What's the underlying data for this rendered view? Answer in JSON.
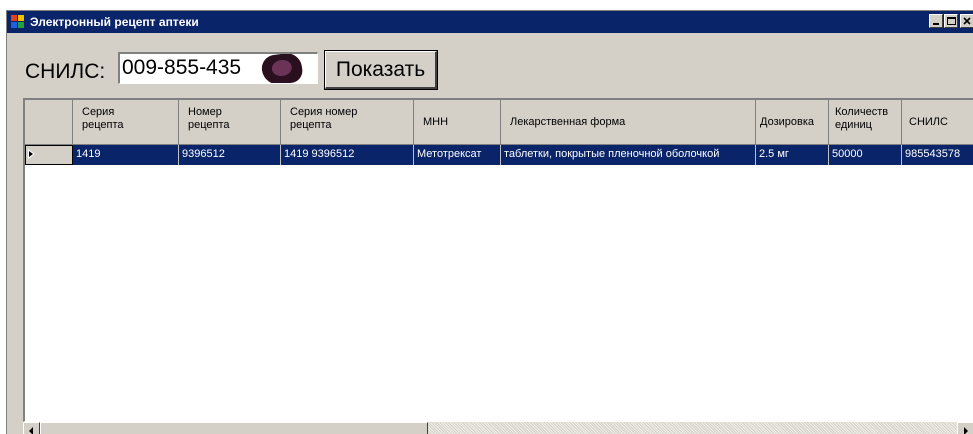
{
  "window": {
    "title": "Электронный рецепт аптеки",
    "controls": [
      "minimize",
      "maximize",
      "close"
    ]
  },
  "search": {
    "label": "СНИЛС:",
    "value": "009-855-435",
    "button_label": "Показать"
  },
  "grid": {
    "columns": [
      {
        "key": "series",
        "label": "Серия\nрецепта"
      },
      {
        "key": "number",
        "label": "Номер\nрецепта"
      },
      {
        "key": "series_number",
        "label": "Серия номер\nрецепта"
      },
      {
        "key": "inn",
        "label": "МНН"
      },
      {
        "key": "form",
        "label": "Лекарственная форма"
      },
      {
        "key": "dosage",
        "label": "Дозировка"
      },
      {
        "key": "quantity",
        "label": "Количеств\nединиц"
      },
      {
        "key": "snils",
        "label": "СНИЛС"
      }
    ],
    "rows": [
      {
        "selected": true,
        "cells": [
          "1419",
          "9396512",
          "1419 9396512",
          "Метотрексат",
          "таблетки, покрытые пленочной оболочкой",
          "2.5 мг",
          "50000",
          "985543578"
        ]
      }
    ]
  },
  "colors": {
    "titlebar": "#0a246a",
    "selection": "#0a246a",
    "face": "#d4d0c8"
  }
}
